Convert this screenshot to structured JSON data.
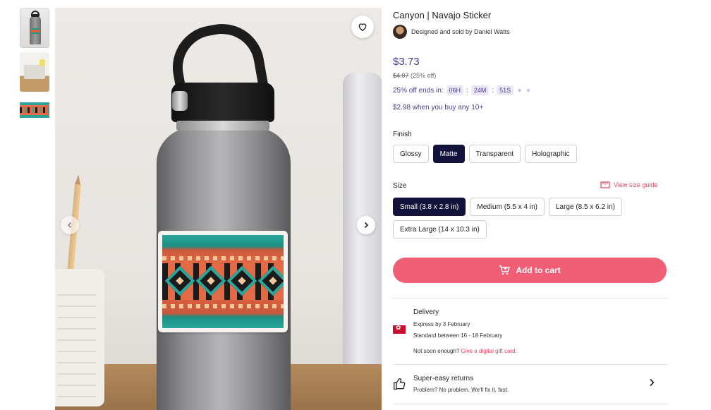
{
  "product": {
    "title": "Canyon | Navajo Sticker",
    "seller_prefix": "Designed and sold by",
    "seller_name": "Daniel Watts",
    "seller_text": "Designed and sold by Daniel Watts"
  },
  "pricing": {
    "price": "$3.73",
    "old_price": "$4.97",
    "discount": "(25% off)",
    "sale_text": "25% off ends in:",
    "countdown": {
      "hours": "06H",
      "minutes": "24M",
      "seconds": "51S"
    },
    "bulk_offer": "$2.98 when you buy any 10+"
  },
  "finish": {
    "label": "Finish",
    "options": [
      "Glossy",
      "Matte",
      "Transparent",
      "Holographic"
    ],
    "selected": "Matte"
  },
  "size": {
    "label": "Size",
    "guide_label": "View size guide",
    "options": [
      "Small (3.8 x 2.8 in)",
      "Medium (5.5 x 4 in)",
      "Large (8.5 x 6.2 in)",
      "Extra Large (14 x 10.3 in)"
    ],
    "selected": "Small (3.8 x 2.8 in)"
  },
  "cart": {
    "label": "Add to cart"
  },
  "delivery": {
    "heading": "Delivery",
    "express": "Express by 3 February",
    "standard": "Standard between 16 - 18 February",
    "not_soon": "Not soon enough?",
    "gift_link": "Give a digital gift card."
  },
  "returns": {
    "heading": "Super-easy returns",
    "subtext": "Problem? No problem. We'll fix it, fast."
  },
  "icons": {
    "favorite": "heart-icon",
    "next": "chevron-right-icon",
    "prev": "chevron-left-icon",
    "cart": "cart-icon",
    "size_guide": "ruler-icon",
    "returns": "thumbs-up-icon",
    "flag": "hong-kong-flag-icon"
  },
  "colors": {
    "accent_purple": "#4b3a8f",
    "cart_pink": "#f25f75",
    "selected_dark": "#12123a",
    "link_red": "#d8475f"
  }
}
